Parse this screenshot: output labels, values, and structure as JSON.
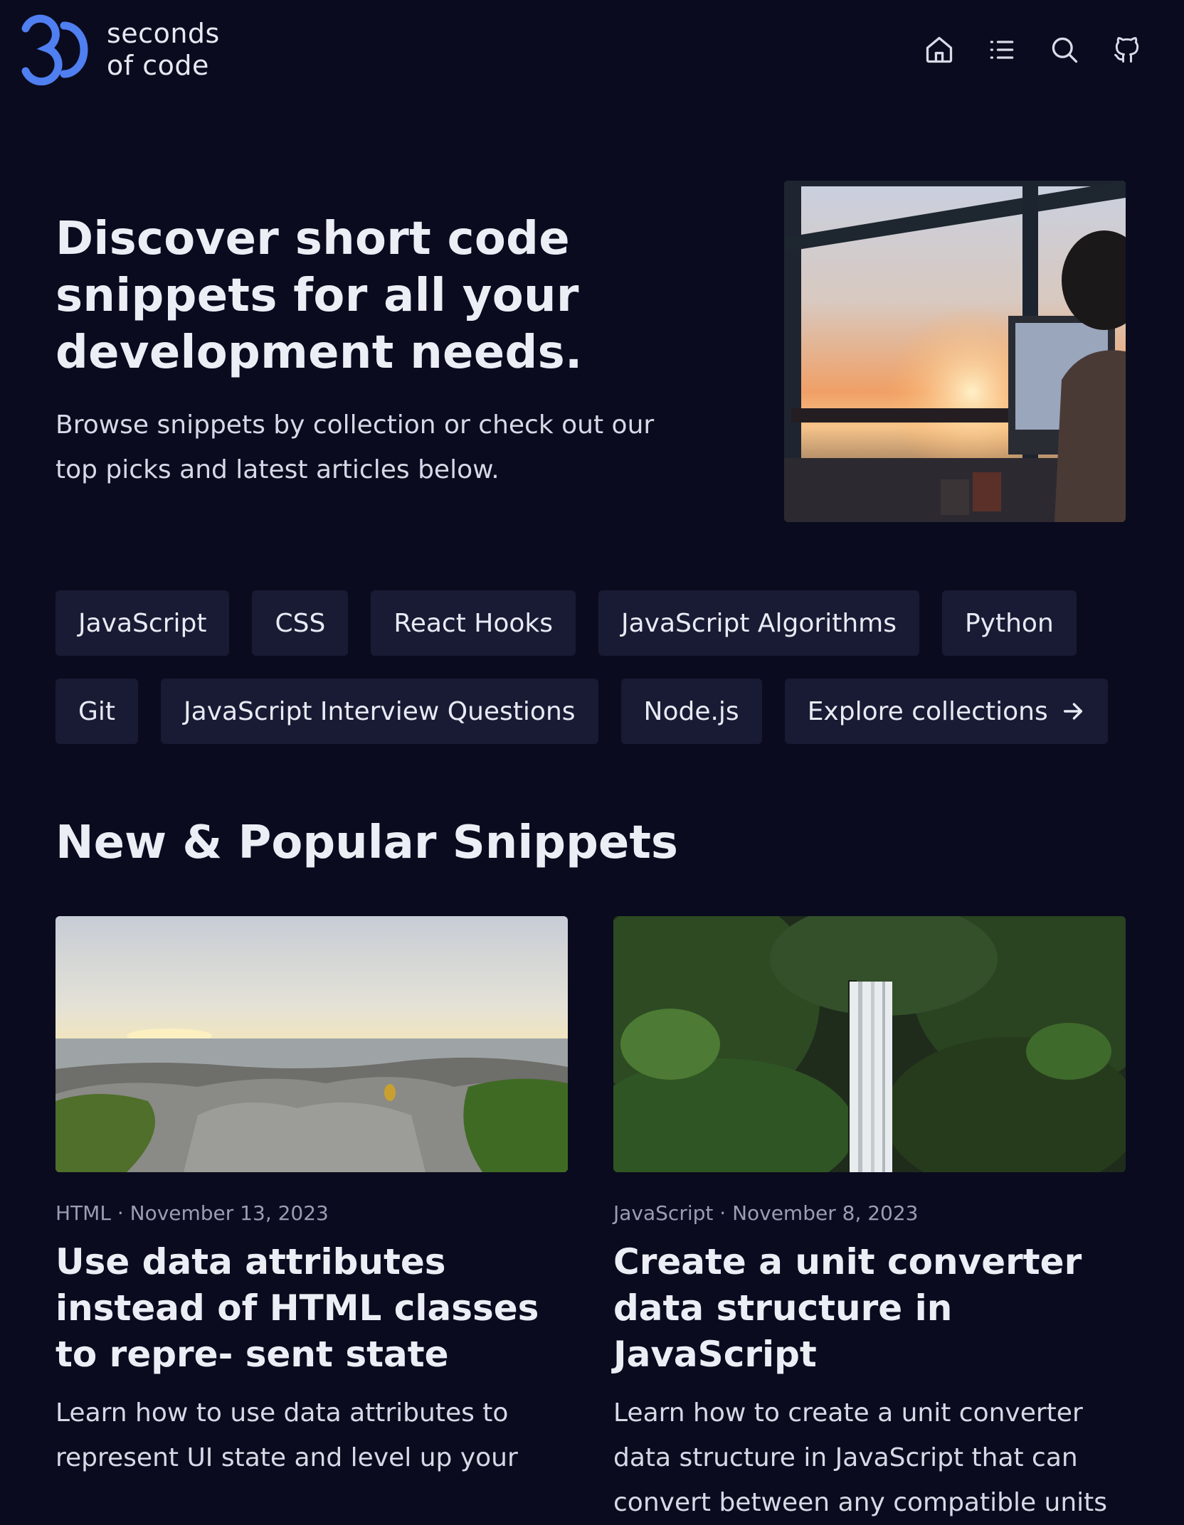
{
  "header": {
    "logo_number": "30",
    "logo_line1": "seconds",
    "logo_line2": "of code",
    "nav_icons": [
      "home-icon",
      "list-icon",
      "search-icon",
      "github-icon"
    ]
  },
  "hero": {
    "title": "Discover short code snippets for all your development needs.",
    "subtitle": "Browse snippets by collection or check out our top picks and latest articles below."
  },
  "tags": [
    {
      "label": "JavaScript"
    },
    {
      "label": "CSS"
    },
    {
      "label": "React Hooks"
    },
    {
      "label": "JavaScript Algorithms"
    },
    {
      "label": "Python"
    },
    {
      "label": "Git"
    },
    {
      "label": "JavaScript Interview Questions"
    },
    {
      "label": "Node.js"
    },
    {
      "label": "Explore collections",
      "icon": "arrow-right-icon"
    }
  ],
  "section": {
    "title": "New & Popular Snippets"
  },
  "cards": [
    {
      "category": "HTML",
      "date": "November 13, 2023",
      "title": "Use data attributes instead of HTML classes to repre- sent state",
      "description": "Learn how to use data attributes to represent UI state and level up your"
    },
    {
      "category": "JavaScript",
      "date": "November 8, 2023",
      "title": "Create a unit converter data structure in JavaScript",
      "description": "Learn how to create a unit converter data structure in JavaScript that can convert between any compatible units"
    }
  ],
  "colors": {
    "background": "#0a0b1e",
    "tag_background": "#191b34",
    "logo_accent": "#4f7ff0",
    "text": "#e6e8f2",
    "muted_text": "#9a9db3"
  }
}
